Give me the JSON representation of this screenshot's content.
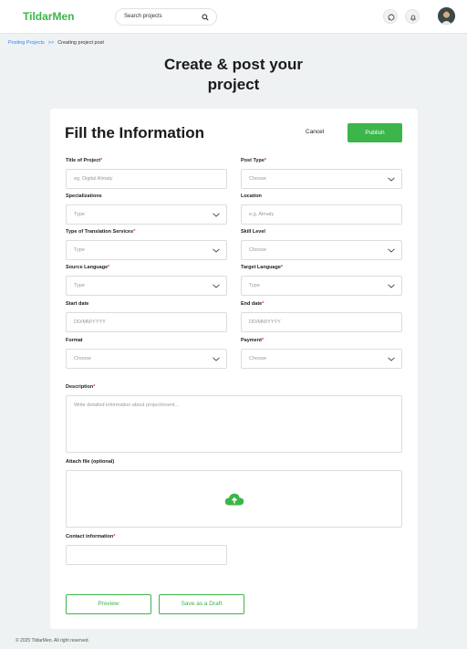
{
  "header": {
    "logo": "TildarMen",
    "search_placeholder": "Search projects"
  },
  "breadcrumb": {
    "link": "Posting Projects",
    "separator": ">>",
    "current": "Creating project post"
  },
  "page_title_line1": "Create & post your",
  "page_title_line2": "project",
  "form": {
    "heading": "Fill the Information",
    "cancel_label": "Cancel",
    "publish_label": "Publish",
    "title": {
      "label": "Title of Project",
      "placeholder": "eg. Digital Almaty"
    },
    "post_type": {
      "label": "Post Type",
      "value": "Choose"
    },
    "specializations": {
      "label": "Specializations",
      "value": "Type"
    },
    "location": {
      "label": "Location",
      "placeholder": "e.g. Almaty"
    },
    "translation_services": {
      "label": "Type of Translation Services",
      "value": "Type"
    },
    "skill_level": {
      "label": "Skill Level",
      "value": "Choose"
    },
    "source_language": {
      "label": "Source Language",
      "value": "Type"
    },
    "target_language": {
      "label": "Target Language",
      "value": "Type"
    },
    "start_date": {
      "label": "Start date",
      "placeholder": "DD/MM/YYYY"
    },
    "end_date": {
      "label": "End date",
      "placeholder": "DD/MM/YYYY"
    },
    "format": {
      "label": "Format",
      "value": "Choose"
    },
    "payment": {
      "label": "Payment",
      "value": "Choose"
    },
    "description": {
      "label": "Description",
      "placeholder": "Write detailed information about project/event..."
    },
    "attach": {
      "label": "Attach file (optional)"
    },
    "contact": {
      "label": "Contact information"
    },
    "preview_label": "Preview",
    "draft_label": "Save as a Draft"
  },
  "footer": "© 2025 TildarMen. All right reserved.",
  "colors": {
    "brand": "#3cb54a",
    "link": "#3b82f6",
    "required": "#e23b3b"
  }
}
